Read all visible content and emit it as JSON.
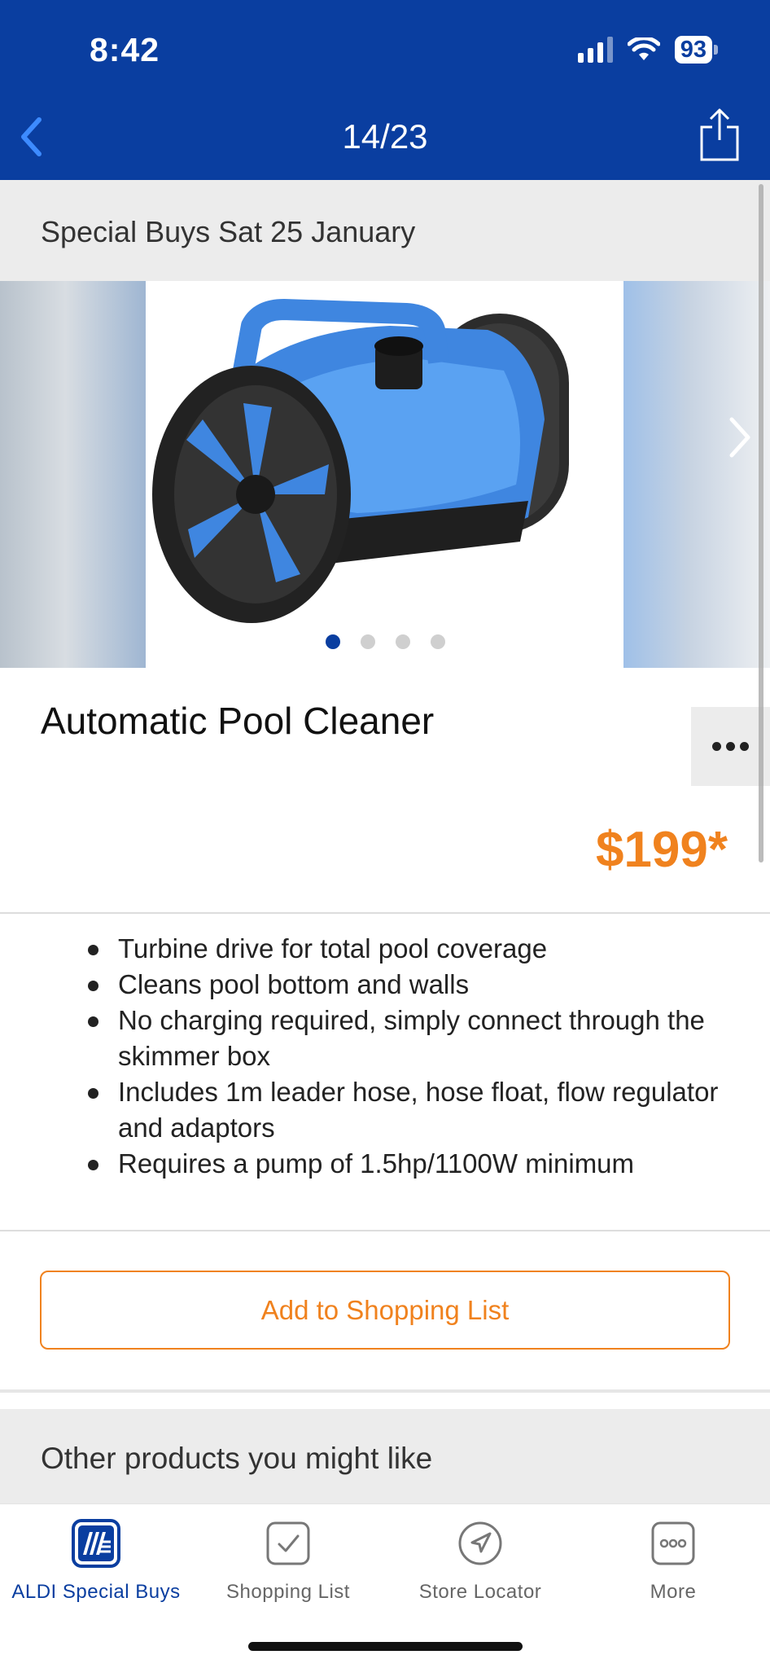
{
  "status_bar": {
    "time": "8:42",
    "battery": "93"
  },
  "nav": {
    "counter": "14/23"
  },
  "page": {
    "date_heading": "Special Buys Sat 25 January",
    "carousel_active_index": 1,
    "carousel_total": 4
  },
  "product": {
    "title": "Automatic Pool Cleaner",
    "price": "$199*",
    "features": [
      "Turbine drive for total pool coverage",
      "Cleans pool bottom and walls",
      "No charging required, simply connect through the skimmer box",
      "Includes 1m leader hose, hose float, flow regulator and adaptors",
      "Requires a pump of 1.5hp/1100W minimum"
    ],
    "add_button": "Add to Shopping List"
  },
  "other": {
    "heading": "Other products you might like"
  },
  "tabbar": {
    "items": [
      {
        "label": "ALDI Special Buys",
        "icon": "aldi-logo-icon",
        "active": true
      },
      {
        "label": "Shopping List",
        "icon": "checklist-icon",
        "active": false
      },
      {
        "label": "Store Locator",
        "icon": "location-arrow-icon",
        "active": false
      },
      {
        "label": "More",
        "icon": "more-icon",
        "active": false
      }
    ]
  },
  "colors": {
    "brand_blue": "#0a3ea0",
    "accent_orange": "#f0821e",
    "band_grey": "#ececec"
  }
}
